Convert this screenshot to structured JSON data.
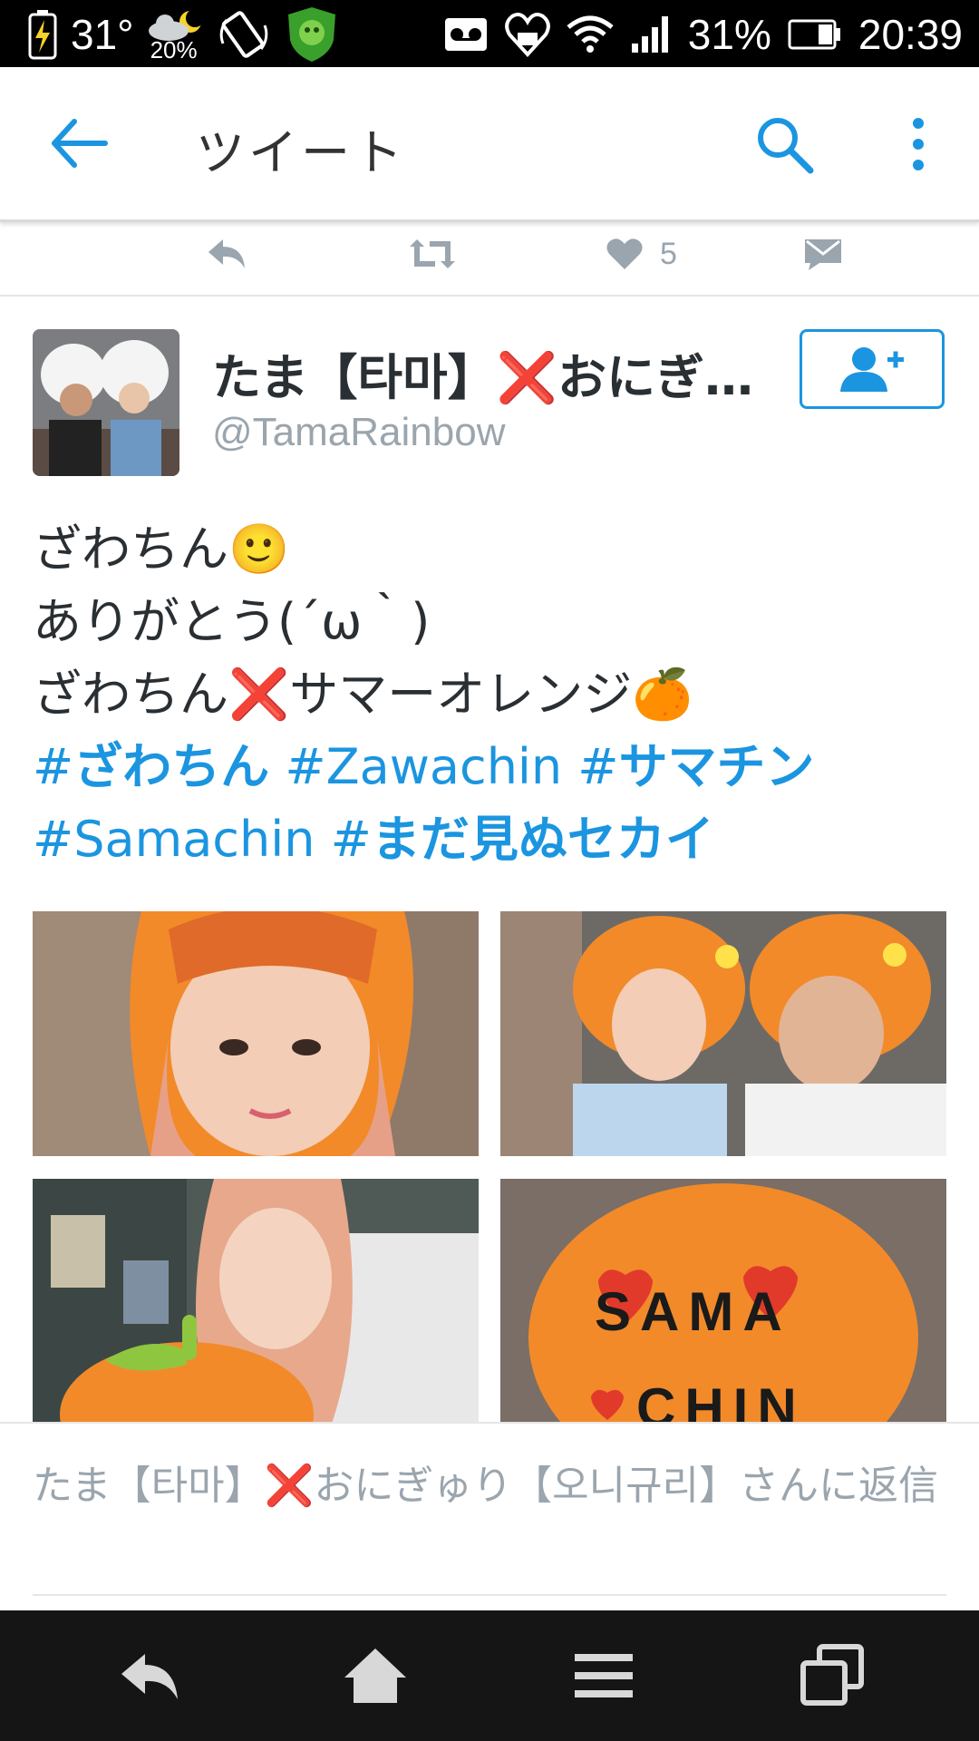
{
  "status_bar": {
    "temperature": "31°",
    "precip": "20%",
    "battery_pct": "31%",
    "time": "20:39"
  },
  "app_bar": {
    "title": "ツイート"
  },
  "tweet_actions": {
    "like_count": "5"
  },
  "tweet": {
    "display_name": "たま【타마】❌おにぎ…",
    "handle": "@TamaRainbow",
    "lines": [
      "ざわちん🙂",
      "ありがとう(´ω｀)",
      "ざわちん❌サマーオレンジ🍊"
    ],
    "hashtags_line1": [
      "#",
      "ざわちん",
      " #Zawachin #",
      "サマチン"
    ],
    "hashtags_line2": [
      "#Samachin #",
      "まだ見ぬセカイ"
    ],
    "photo_texts": [
      "SAMA",
      "CHIN"
    ]
  },
  "reply_bar": {
    "text": "たま【타마】❌おにぎゅり【오니규리】さんに返信"
  },
  "colors": {
    "accent": "#1b95e0",
    "muted": "#9aa5ae",
    "text": "#292f33",
    "orange": "#f08a24"
  }
}
